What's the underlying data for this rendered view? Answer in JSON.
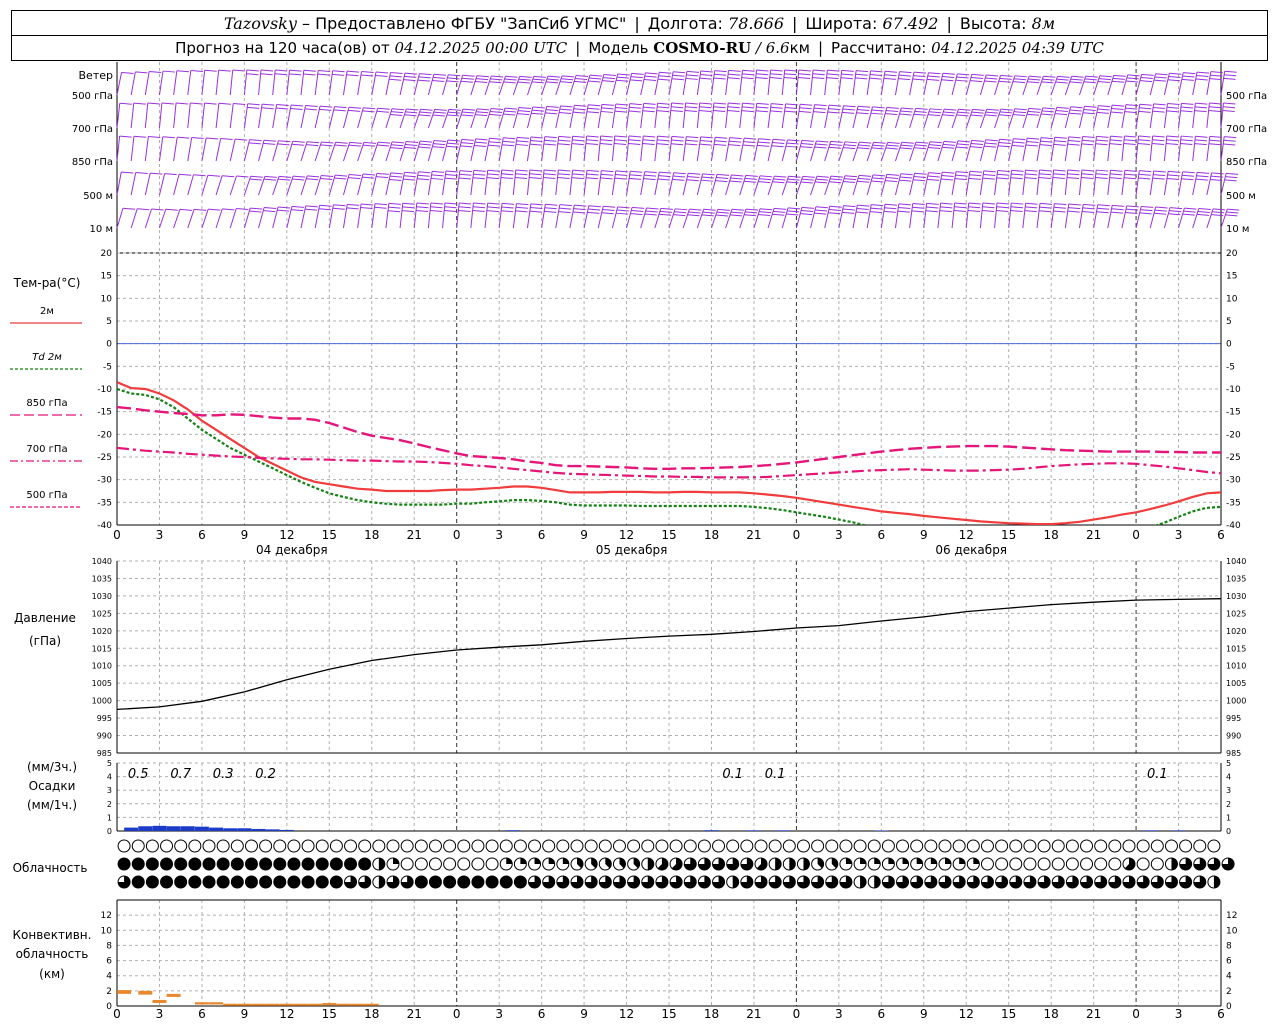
{
  "header": {
    "station": "Tazovsky",
    "provider": "– Предоставлено ФГБУ \"ЗапСиб УГМС\"",
    "lon_label": "Долгота:",
    "lon_value": "78.666",
    "lat_label": "Широта:",
    "lat_value": "67.492",
    "alt_label": "Высота:",
    "alt_value": "8м",
    "forecast_label": "Прогноз на 120 часа(ов) от",
    "forecast_start": "04.12.2025 00:00 UTC",
    "model_label": "Модель",
    "model_name": "COSMO-RU",
    "model_res_italic": "/ 6.6",
    "model_res_unit": "км",
    "calc_label": "Рассчитано:",
    "calc_time": "04.12.2025 04:39 UTC"
  },
  "colors": {
    "t2m": "#f03c3c",
    "td2m": "#128212",
    "t850": "#e5157a",
    "t700": "#e5157a",
    "t500": "#e5157a",
    "zero_line": "#4a6ae0",
    "pressure": "#000000",
    "precip": "#1c3cc8",
    "convective": "#e8892e",
    "wind": "#9a2fe0"
  },
  "chart_data": {
    "type": "line",
    "x_ticks": [
      "0",
      "3",
      "6",
      "9",
      "12",
      "15",
      "18",
      "21",
      "0",
      "3",
      "6",
      "9",
      "12",
      "15",
      "18",
      "21",
      "0",
      "3",
      "6",
      "9",
      "12",
      "15",
      "18",
      "21",
      "0",
      "3",
      "6"
    ],
    "day_labels": [
      "04 декабря",
      "05 декабря",
      "06 декабря"
    ],
    "hours_range": [
      0,
      78
    ],
    "wind": {
      "title": "Ветер",
      "levels": [
        "500 гПа",
        "700 гПа",
        "850 гПа",
        "500 м",
        "10  м"
      ]
    },
    "temperature": {
      "title": "Тем-ра(°C)",
      "ylim": [
        -40,
        20
      ],
      "y_ticks": [
        "20",
        "15",
        "10",
        "5",
        "0",
        "-5",
        "-10",
        "-15",
        "-20",
        "-25",
        "-30",
        "-35",
        "-40"
      ],
      "legend": [
        "2м",
        "Td 2м",
        "850 гПа",
        "700 гПа",
        "500 гПа"
      ],
      "x": [
        0,
        1,
        2,
        3,
        4,
        5,
        6,
        7,
        8,
        9,
        10,
        11,
        12,
        13,
        14,
        15,
        16,
        17,
        18,
        19,
        20,
        21,
        22,
        23,
        24,
        25,
        26,
        27,
        28,
        29,
        30,
        31,
        32,
        33,
        34,
        35,
        36,
        37,
        38,
        39,
        40,
        41,
        42,
        43,
        44,
        45,
        46,
        47,
        48,
        49,
        50,
        51,
        52,
        53,
        54,
        55,
        56,
        57,
        58,
        59,
        60,
        61,
        62,
        63,
        64,
        65,
        66,
        67,
        68,
        69,
        70,
        71,
        72,
        73,
        74,
        75,
        76,
        77,
        78
      ],
      "series": [
        {
          "name": "2м",
          "values": [
            -8.5,
            -9.8,
            -10,
            -11,
            -12.5,
            -14.5,
            -17,
            -19,
            -21,
            -23,
            -25,
            -26.5,
            -28,
            -29.5,
            -30.5,
            -31,
            -31.5,
            -32,
            -32.2,
            -32.5,
            -32.5,
            -32.5,
            -32.5,
            -32.3,
            -32.2,
            -32.2,
            -32,
            -31.8,
            -31.5,
            -31.5,
            -31.8,
            -32.3,
            -32.8,
            -32.8,
            -32.8,
            -32.7,
            -32.7,
            -32.7,
            -32.8,
            -32.8,
            -32.7,
            -32.7,
            -32.8,
            -32.8,
            -32.8,
            -33,
            -33.3,
            -33.6,
            -34,
            -34.5,
            -35,
            -35.5,
            -36,
            -36.5,
            -37,
            -37.3,
            -37.6,
            -38,
            -38.3,
            -38.6,
            -38.9,
            -39.2,
            -39.4,
            -39.6,
            -39.7,
            -39.8,
            -39.8,
            -39.6,
            -39.3,
            -38.8,
            -38.3,
            -37.7,
            -37.2,
            -36.5,
            -35.7,
            -34.8,
            -33.8,
            -33,
            -32.8
          ]
        },
        {
          "name": "Td 2м",
          "values": [
            -10,
            -11,
            -11.3,
            -12.3,
            -14,
            -16.5,
            -19,
            -21,
            -23,
            -24.5,
            -26,
            -27.5,
            -29,
            -30.5,
            -31.8,
            -33,
            -33.8,
            -34.5,
            -35,
            -35.3,
            -35.5,
            -35.5,
            -35.5,
            -35.5,
            -35.3,
            -35.3,
            -35,
            -34.8,
            -34.5,
            -34.5,
            -34.7,
            -35,
            -35.5,
            -35.7,
            -35.7,
            -35.7,
            -35.7,
            -35.8,
            -35.8,
            -35.8,
            -35.8,
            -35.8,
            -35.8,
            -35.8,
            -35.8,
            -36,
            -36.3,
            -36.7,
            -37.2,
            -37.7,
            -38.2,
            -38.8,
            -39.4,
            -40.2,
            -41,
            -41.5,
            -42,
            -42.5,
            -42.8,
            -43,
            -43.2,
            -43.3,
            -43.3,
            -43.2,
            -43,
            -42.8,
            -42.5,
            -42.2,
            -41.9,
            -41.6,
            -41.3,
            -41,
            -40.8,
            -40.5,
            -39.5,
            -38.2,
            -37,
            -36.2,
            -36
          ]
        },
        {
          "name": "850 гПа",
          "values": [
            -14,
            -14.3,
            -14.7,
            -15,
            -15.3,
            -15.5,
            -15.8,
            -15.8,
            -15.6,
            -15.7,
            -16,
            -16.3,
            -16.5,
            -16.5,
            -16.8,
            -17.5,
            -18.5,
            -19.5,
            -20.3,
            -20.8,
            -21.3,
            -22,
            -22.8,
            -23.5,
            -24.2,
            -24.8,
            -25,
            -25.2,
            -25.5,
            -26,
            -26.3,
            -26.8,
            -27,
            -27,
            -27.1,
            -27.2,
            -27.3,
            -27.5,
            -27.6,
            -27.6,
            -27.5,
            -27.5,
            -27.4,
            -27.3,
            -27.2,
            -27,
            -26.8,
            -26.5,
            -26.2,
            -25.8,
            -25.4,
            -25,
            -24.6,
            -24.2,
            -23.8,
            -23.5,
            -23.2,
            -23,
            -22.8,
            -22.7,
            -22.6,
            -22.6,
            -22.6,
            -22.7,
            -22.9,
            -23.1,
            -23.3,
            -23.5,
            -23.6,
            -23.7,
            -23.8,
            -23.8,
            -23.8,
            -23.8,
            -23.9,
            -23.9,
            -24,
            -24,
            -24
          ]
        },
        {
          "name": "700 гПа",
          "values": [
            -23,
            -23.3,
            -23.6,
            -23.8,
            -24,
            -24.3,
            -24.5,
            -24.7,
            -24.9,
            -25,
            -25.2,
            -25.3,
            -25.4,
            -25.5,
            -25.5,
            -25.6,
            -25.7,
            -25.8,
            -25.8,
            -25.9,
            -26,
            -26,
            -26.1,
            -26.3,
            -26.5,
            -26.8,
            -27,
            -27.3,
            -27.6,
            -27.9,
            -28.2,
            -28.5,
            -28.7,
            -28.8,
            -28.9,
            -29,
            -29.1,
            -29.2,
            -29.3,
            -29.3,
            -29.4,
            -29.4,
            -29.5,
            -29.5,
            -29.5,
            -29.5,
            -29.4,
            -29.2,
            -29,
            -28.8,
            -28.6,
            -28.4,
            -28.2,
            -28,
            -27.9,
            -27.8,
            -27.7,
            -27.8,
            -27.9,
            -28,
            -28,
            -28,
            -27.9,
            -27.8,
            -27.6,
            -27.3,
            -27,
            -26.8,
            -26.6,
            -26.5,
            -26.4,
            -26.4,
            -26.5,
            -26.8,
            -27.1,
            -27.5,
            -27.9,
            -28.3,
            -28.6
          ]
        }
      ]
    },
    "pressure": {
      "title": "Давление",
      "unit": "(гПа)",
      "ylim": [
        985,
        1040
      ],
      "y_ticks": [
        "1040",
        "1035",
        "1030",
        "1025",
        "1020",
        "1015",
        "1010",
        "1005",
        "1000",
        "995",
        "990",
        "985"
      ],
      "x": [
        0,
        3,
        6,
        9,
        12,
        15,
        18,
        21,
        24,
        27,
        30,
        33,
        36,
        39,
        42,
        45,
        48,
        51,
        54,
        57,
        60,
        63,
        66,
        69,
        72,
        75,
        78
      ],
      "values": [
        997.5,
        998.2,
        999.8,
        1002.5,
        1006,
        1009,
        1011.5,
        1013.2,
        1014.5,
        1015.3,
        1016,
        1017,
        1017.8,
        1018.5,
        1019,
        1019.8,
        1020.8,
        1021.5,
        1022.8,
        1024,
        1025.5,
        1026.5,
        1027.5,
        1028.2,
        1028.8,
        1029,
        1029.2
      ]
    },
    "precipitation": {
      "title_top": "(мм/3ч.)",
      "title_mid": "Осадки",
      "title_bot": "(мм/1ч.)",
      "ylim": [
        0,
        5
      ],
      "y_ticks": [
        "5",
        "4",
        "3",
        "2",
        "1",
        "0"
      ],
      "totals": [
        {
          "x": 1.5,
          "label": "0.5"
        },
        {
          "x": 4.5,
          "label": "0.7"
        },
        {
          "x": 7.5,
          "label": "0.3"
        },
        {
          "x": 10.5,
          "label": "0.2"
        },
        {
          "x": 43.5,
          "label": "0.1"
        },
        {
          "x": 46.5,
          "label": "0.1"
        },
        {
          "x": 73.5,
          "label": "0.1"
        }
      ],
      "bars": [
        [
          1,
          0.25
        ],
        [
          2,
          0.35
        ],
        [
          3,
          0.38
        ],
        [
          4,
          0.35
        ],
        [
          5,
          0.35
        ],
        [
          6,
          0.32
        ],
        [
          7,
          0.25
        ],
        [
          8,
          0.2
        ],
        [
          9,
          0.2
        ],
        [
          10,
          0.15
        ],
        [
          11,
          0.12
        ],
        [
          12,
          0.08
        ],
        [
          28,
          0.06
        ],
        [
          42,
          0.06
        ],
        [
          45,
          0.05
        ],
        [
          47,
          0.05
        ],
        [
          54,
          0.04
        ],
        [
          73,
          0.05
        ],
        [
          75,
          0.05
        ]
      ]
    },
    "clouds": {
      "title": "Облачность",
      "upper": [
        0,
        0,
        0,
        0,
        0,
        0,
        0,
        0,
        0,
        0,
        0,
        0,
        0,
        0,
        0,
        0,
        0,
        0,
        0,
        0,
        0,
        0,
        0,
        0,
        0,
        0,
        0,
        0,
        0,
        0,
        0,
        0,
        0,
        0,
        0,
        0,
        0,
        0,
        0,
        0,
        0,
        0,
        0,
        0,
        0,
        0,
        0,
        0,
        0,
        0,
        0,
        0,
        0,
        0,
        0,
        0,
        0,
        0,
        0,
        0,
        0,
        0,
        0,
        0,
        0,
        0,
        0,
        0,
        0,
        0,
        0,
        0,
        0,
        0,
        0,
        0,
        0,
        0
      ],
      "middle": [
        8,
        8,
        8,
        8,
        8,
        8,
        8,
        8,
        8,
        8,
        8,
        8,
        8,
        8,
        8,
        8,
        8,
        8,
        4,
        2,
        0,
        0,
        0,
        0,
        0,
        0,
        0,
        2,
        2,
        2,
        2,
        2,
        3,
        3,
        3,
        3,
        3,
        4,
        5,
        5,
        6,
        6,
        6,
        6,
        6,
        5,
        4,
        4,
        4,
        3,
        3,
        2,
        2,
        2,
        2,
        2,
        2,
        2,
        2,
        2,
        2,
        0,
        0,
        0,
        0,
        0,
        0,
        0,
        0,
        0,
        0,
        5,
        0,
        0,
        4,
        6,
        6,
        6,
        6
      ],
      "lower": [
        6,
        8,
        8,
        8,
        8,
        8,
        8,
        8,
        8,
        8,
        8,
        8,
        8,
        8,
        8,
        8,
        6,
        6,
        4,
        6,
        6,
        8,
        8,
        8,
        8,
        8,
        8,
        8,
        8,
        6,
        6,
        6,
        6,
        6,
        6,
        6,
        6,
        6,
        6,
        6,
        6,
        6,
        6,
        4,
        6,
        6,
        6,
        6,
        6,
        6,
        6,
        6,
        4,
        4,
        6,
        6,
        6,
        6,
        6,
        6,
        6,
        6,
        6,
        6,
        6,
        6,
        6,
        6,
        6,
        6,
        6,
        6,
        6,
        6,
        6,
        6,
        6,
        4
      ]
    },
    "convective": {
      "title1": "Конвективн.",
      "title2": "облачность",
      "title3": "(км)",
      "ylim": [
        0,
        14
      ],
      "y_ticks": [
        "12",
        "10",
        "8",
        "6",
        "4",
        "2",
        "0"
      ],
      "bars": [
        [
          0.5,
          1.6,
          2.1
        ],
        [
          2,
          1.5,
          2
        ],
        [
          3,
          0.4,
          0.8
        ],
        [
          4,
          1.2,
          1.6
        ],
        [
          6,
          0.2,
          0.5
        ],
        [
          7,
          0.2,
          0.5
        ],
        [
          8,
          0.1,
          0.3
        ],
        [
          9,
          0.1,
          0.3
        ],
        [
          10,
          0.1,
          0.3
        ],
        [
          11,
          0.1,
          0.3
        ],
        [
          12,
          0.1,
          0.3
        ],
        [
          13,
          0.1,
          0.3
        ],
        [
          14,
          0.1,
          0.3
        ],
        [
          15,
          0.1,
          0.4
        ],
        [
          16,
          0.1,
          0.3
        ],
        [
          17,
          0.1,
          0.3
        ],
        [
          18,
          0.1,
          0.3
        ]
      ]
    }
  }
}
